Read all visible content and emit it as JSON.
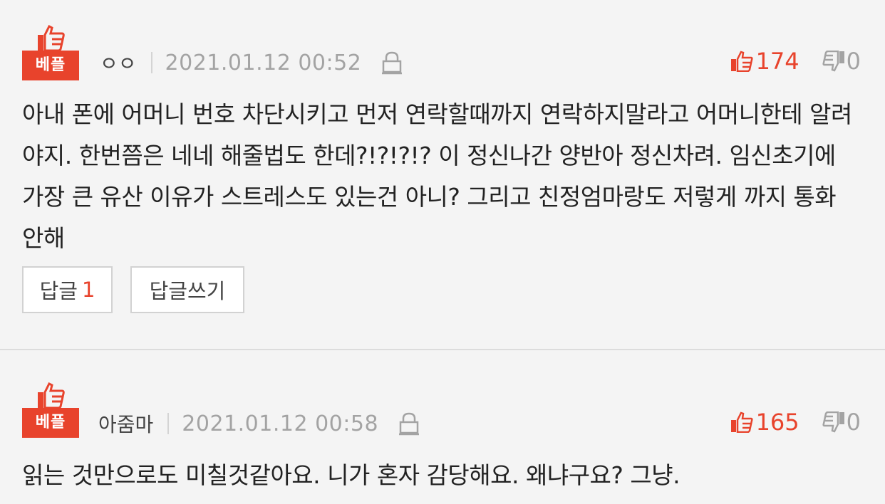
{
  "comments": [
    {
      "badge": "베플",
      "author": "ㅇㅇ",
      "date": "2021.01.12 00:52",
      "upvotes": "174",
      "downvotes": "0",
      "body": "아내 폰에 어머니 번호 차단시키고 먼저 연락할때까지 연락하지말라고 어머니한테 알려야지. 한번쯤은 네네 해줄법도 한데?!?!?!? 이 정신나간 양반아 정신차려. 임신초기에 가장 큰 유산 이유가 스트레스도 있는건 아니? 그리고 친정엄마랑도 저렇게 까지 통화 안해",
      "reply_label": "답글",
      "reply_count": "1",
      "write_reply_label": "답글쓰기"
    },
    {
      "badge": "베플",
      "author": "아줌마",
      "date": "2021.01.12 00:58",
      "upvotes": "165",
      "downvotes": "0",
      "body": "읽는 것만으로도 미칠것같아요. 니가 혼자 감당해요. 왜냐구요? 그냥."
    }
  ],
  "colors": {
    "accent": "#e8432c",
    "muted": "#a3a3a3",
    "background": "#f4f4f4"
  },
  "icons": {
    "badge": "thumbs-up-icon",
    "lock": "lock-icon",
    "upvote": "thumbs-up-outline-icon",
    "downvote": "thumbs-down-outline-icon"
  }
}
